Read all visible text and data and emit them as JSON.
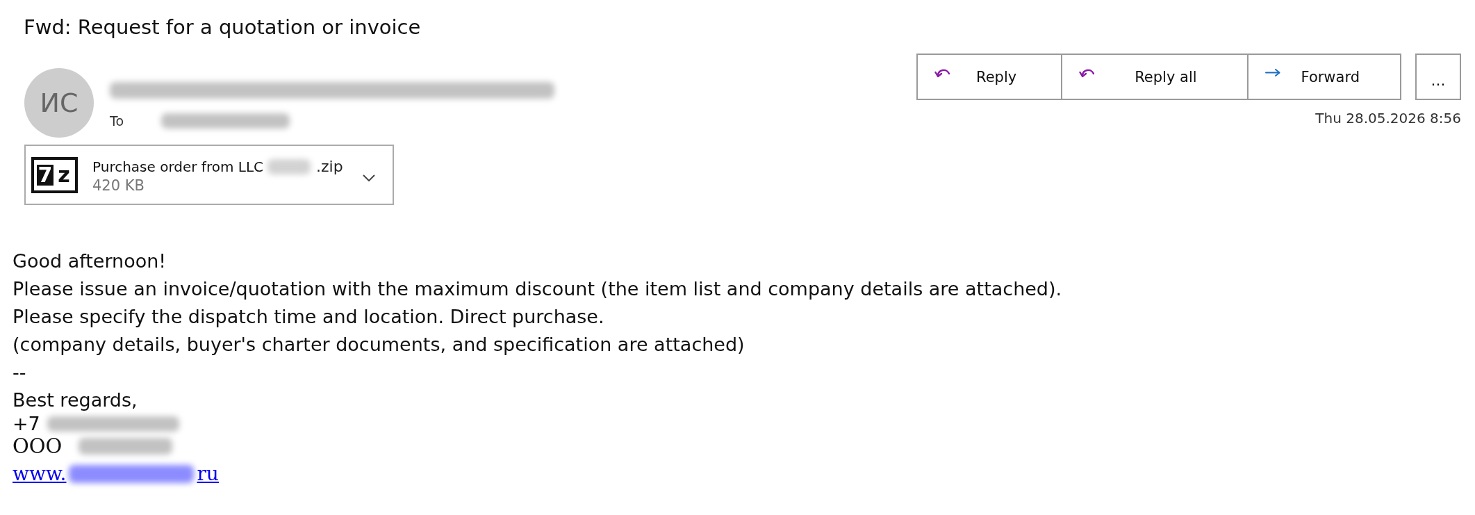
{
  "message": {
    "subject": "Fwd: Request for a quotation or invoice"
  },
  "sender": {
    "initials": "ИС",
    "to_label": "To"
  },
  "attachment": {
    "icon_glyphs": [
      "7",
      "z"
    ],
    "name": "Purchase order from LLC",
    "extension": ".zip",
    "size": "420 KB"
  },
  "actions": [
    {
      "kind": "reply",
      "label": "Reply"
    },
    {
      "kind": "reply_all",
      "label": "Reply all"
    },
    {
      "kind": "forward",
      "label": "Forward"
    }
  ],
  "more_button": "...",
  "date": "Thu 28.05.2026 8:56",
  "body": {
    "lines": [
      "Good afternoon!",
      "Please issue an invoice/quotation with the maximum discount (the item list and company details are attached).",
      "Please specify the dispatch time and location. Direct purchase.",
      "(company details, buyer's charter documents, and specification are attached)",
      "--",
      "Best regards,"
    ]
  },
  "signature": {
    "phone_prefix": "+7",
    "company_prefix": "OOO",
    "website": {
      "start": "www.",
      "end": "ru"
    }
  }
}
